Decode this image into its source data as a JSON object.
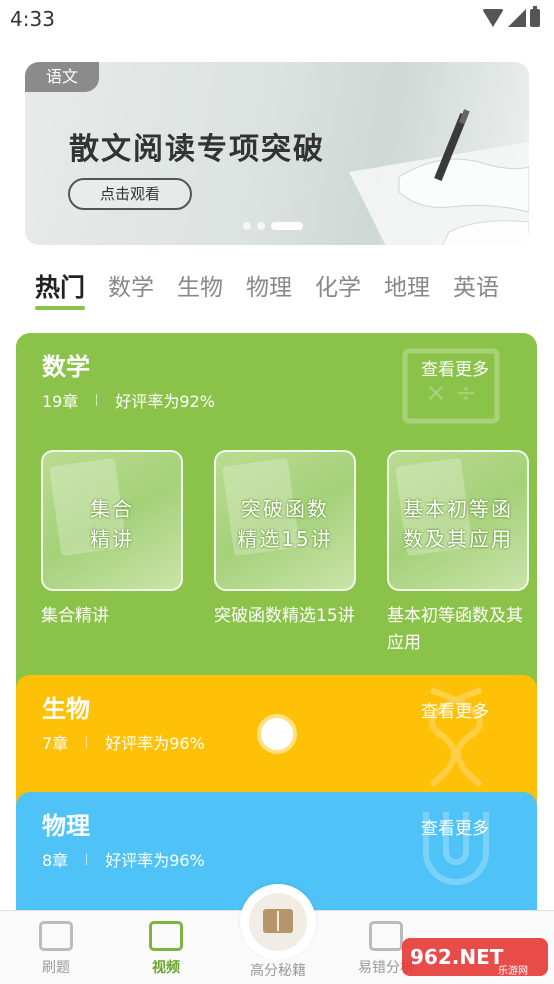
{
  "status_bar": {
    "time": "4:33"
  },
  "banner": {
    "tag": "语文",
    "title": "散文阅读专项突破",
    "button_label": "点击观看"
  },
  "tabs": [
    "热门",
    "数学",
    "生物",
    "物理",
    "化学",
    "地理",
    "英语"
  ],
  "cards": {
    "math": {
      "title": "数学",
      "chapters": "19章",
      "rating": "好评率为92%",
      "more": "查看更多",
      "courses": [
        {
          "thumb_line1": "集合",
          "thumb_line2": "精讲",
          "name": "集合精讲"
        },
        {
          "thumb_line1": "突破函数",
          "thumb_line2": "精选15讲",
          "name": "突破函数精选15讲"
        },
        {
          "thumb_line1": "基本初等函",
          "thumb_line2": "数及其应用",
          "name": "基本初等函数及其应用"
        }
      ]
    },
    "bio": {
      "title": "生物",
      "chapters": "7章",
      "rating": "好评率为96%",
      "more": "查看更多"
    },
    "phys": {
      "title": "物理",
      "chapters": "8章",
      "rating": "好评率为96%",
      "more": "查看更多"
    }
  },
  "bottom_nav": {
    "items": [
      {
        "label": "刷题",
        "icon": "printer-icon"
      },
      {
        "label": "视频",
        "icon": "video-icon"
      },
      {
        "label": "高分秘籍",
        "icon": "book-icon"
      },
      {
        "label": "易错分析",
        "icon": "chart-icon"
      }
    ]
  },
  "watermark": {
    "text": "962.NET",
    "sub": "乐游网"
  },
  "colors": {
    "math": "#8bc34a",
    "bio": "#ffc107",
    "phys": "#4fc3f7",
    "accent": "#7cb342"
  }
}
